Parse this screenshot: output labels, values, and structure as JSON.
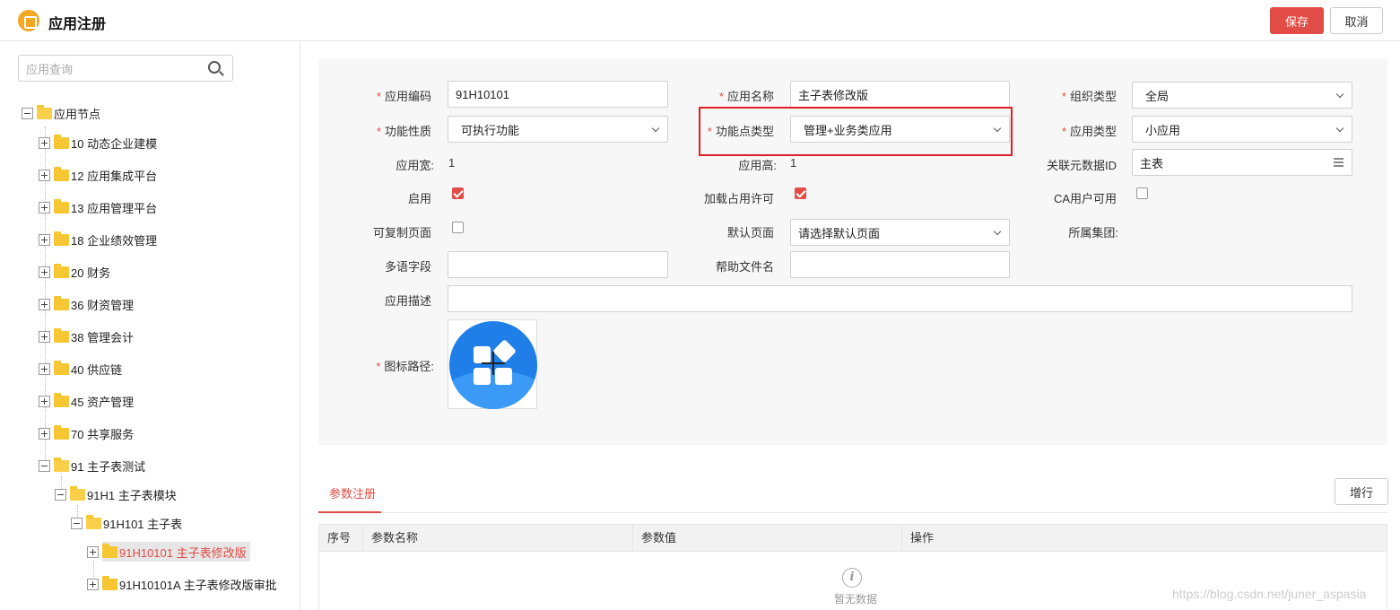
{
  "header": {
    "title": "应用注册",
    "save_label": "保存",
    "cancel_label": "取消"
  },
  "sidebar": {
    "search_placeholder": "应用查询",
    "tree": [
      {
        "label": "应用节点"
      },
      {
        "label": "10 动态企业建模"
      },
      {
        "label": "12 应用集成平台"
      },
      {
        "label": "13 应用管理平台"
      },
      {
        "label": "18 企业绩效管理"
      },
      {
        "label": "20 财务"
      },
      {
        "label": "36 财资管理"
      },
      {
        "label": "38 管理会计"
      },
      {
        "label": "40 供应链"
      },
      {
        "label": "45 资产管理"
      },
      {
        "label": "70 共享服务"
      },
      {
        "label": "91 主子表测试"
      },
      {
        "label": "91H1 主子表模块"
      },
      {
        "label": "91H101 主子表"
      },
      {
        "label": "91H10101 主子表修改版"
      },
      {
        "label": "91H10101A 主子表修改版审批"
      }
    ]
  },
  "form": {
    "app_code": {
      "label": "应用编码",
      "value": "91H10101"
    },
    "app_name": {
      "label": "应用名称",
      "value": "主子表修改版"
    },
    "org_type": {
      "label": "组织类型",
      "value": "全局"
    },
    "func_nature": {
      "label": "功能性质",
      "value": "可执行功能"
    },
    "func_point_type": {
      "label": "功能点类型",
      "value": "管理+业务类应用"
    },
    "app_type": {
      "label": "应用类型",
      "value": "小应用"
    },
    "app_width": {
      "label": "应用宽:",
      "value": "1"
    },
    "app_height": {
      "label": "应用高:",
      "value": "1"
    },
    "meta_id": {
      "label": "关联元数据ID",
      "value": "主表"
    },
    "enabled": {
      "label": "启用",
      "checked": true
    },
    "load_license": {
      "label": "加载占用许可",
      "checked": true
    },
    "ca_user": {
      "label": "CA用户可用",
      "checked": false
    },
    "copyable_page": {
      "label": "可复制页面",
      "checked": false
    },
    "default_page": {
      "label": "默认页面",
      "value": "请选择默认页面"
    },
    "group": {
      "label": "所属集团:"
    },
    "multilang": {
      "label": "多语字段",
      "value": ""
    },
    "help_file": {
      "label": "帮助文件名",
      "value": ""
    },
    "description": {
      "label": "应用描述",
      "value": ""
    },
    "icon_path": {
      "label": "图标路径:"
    },
    "required_mark": "*"
  },
  "params": {
    "tab_label": "参数注册",
    "add_row_label": "增行",
    "columns": [
      "序号",
      "参数名称",
      "参数值",
      "操作"
    ],
    "empty_text": "暂无数据",
    "empty_icon_glyph": "i"
  },
  "watermark": "https://blog.csdn.net/juner_aspasia",
  "colors": {
    "accent": "#e14c46",
    "highlight_border": "#e02020",
    "icon_blue": "#1f7ee8",
    "folder": "#f7c633"
  }
}
